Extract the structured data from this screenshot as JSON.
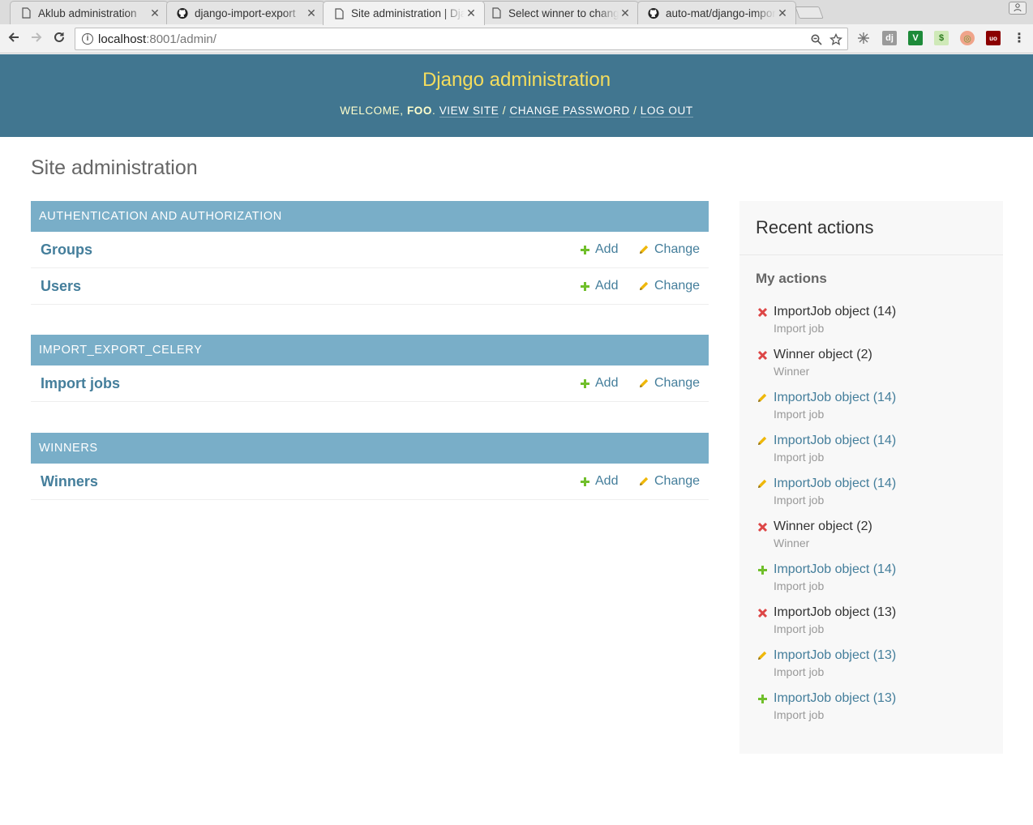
{
  "browser": {
    "tabs": [
      {
        "title": "Aklub administration",
        "favicon": "page-icon"
      },
      {
        "title": "django-import-export",
        "favicon": "github-icon"
      },
      {
        "title": "Site administration | Django",
        "favicon": "page-icon",
        "active": true
      },
      {
        "title": "Select winner to change",
        "favicon": "page-icon"
      },
      {
        "title": "auto-mat/django-import",
        "favicon": "github-icon"
      }
    ],
    "url_host": "localhost",
    "url_rest": ":8001/admin/"
  },
  "header": {
    "site_title": "Django administration",
    "welcome": "Welcome,",
    "username": "foo",
    "view_site": "View site",
    "change_password": "Change password",
    "log_out": "Log out"
  },
  "page_title": "Site administration",
  "modules": [
    {
      "caption": "Authentication and Authorization",
      "models": [
        {
          "name": "Groups"
        },
        {
          "name": "Users"
        }
      ]
    },
    {
      "caption": "IMPORT_EXPORT_CELERY",
      "models": [
        {
          "name": "Import jobs"
        }
      ]
    },
    {
      "caption": "Winners",
      "models": [
        {
          "name": "Winners"
        }
      ]
    }
  ],
  "actions": {
    "add_label": "Add",
    "change_label": "Change"
  },
  "recent": {
    "title": "Recent actions",
    "subtitle": "My actions",
    "items": [
      {
        "type": "delete",
        "object": "ImportJob object (14)",
        "content_type": "Import job"
      },
      {
        "type": "delete",
        "object": "Winner object (2)",
        "content_type": "Winner"
      },
      {
        "type": "change",
        "object": "ImportJob object (14)",
        "content_type": "Import job"
      },
      {
        "type": "change",
        "object": "ImportJob object (14)",
        "content_type": "Import job"
      },
      {
        "type": "change",
        "object": "ImportJob object (14)",
        "content_type": "Import job"
      },
      {
        "type": "delete",
        "object": "Winner object (2)",
        "content_type": "Winner"
      },
      {
        "type": "add",
        "object": "ImportJob object (14)",
        "content_type": "Import job"
      },
      {
        "type": "delete",
        "object": "ImportJob object (13)",
        "content_type": "Import job"
      },
      {
        "type": "change",
        "object": "ImportJob object (13)",
        "content_type": "Import job"
      },
      {
        "type": "add",
        "object": "ImportJob object (13)",
        "content_type": "Import job"
      }
    ]
  },
  "colors": {
    "header_bg": "#417690",
    "title": "#f5dd5d",
    "caption_bg": "#79aec8",
    "link": "#447e9b",
    "add": "#70bf2b",
    "change": "#efb80b",
    "delete": "#dd4646"
  }
}
